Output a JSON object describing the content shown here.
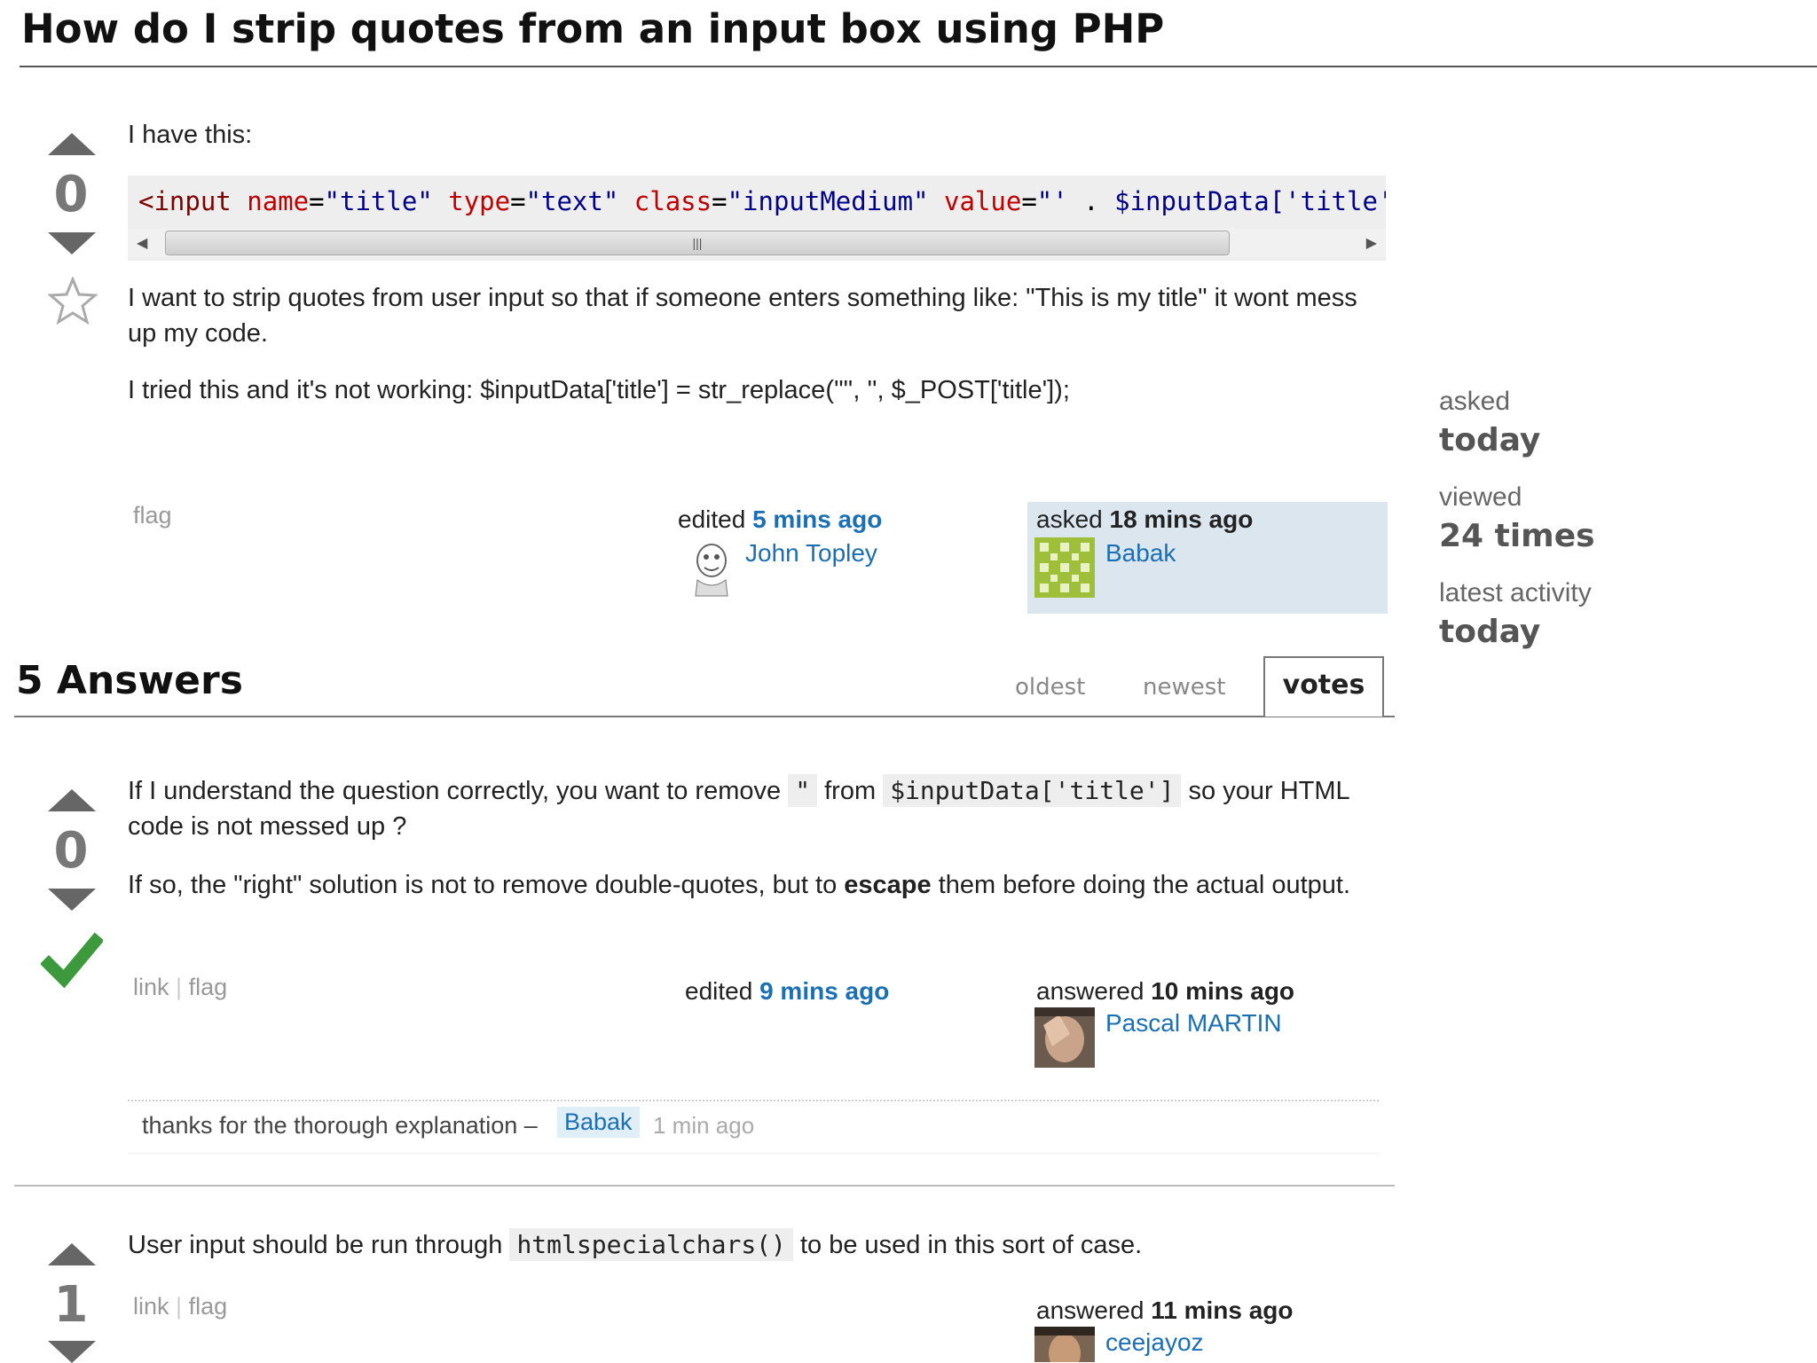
{
  "question": {
    "title": "How do I strip quotes from an input box using PHP",
    "votes": "0",
    "intro": "I have this:",
    "code": {
      "tag": "<input",
      "a1": "name",
      "v1": "\"title\"",
      "a2": "type",
      "v2": "\"text\"",
      "a3": "class",
      "v3": "\"inputMedium\"",
      "a4": "value",
      "v4": "\"'",
      "dot": " . ",
      "var": "$inputData['title']"
    },
    "para1": "I want to strip quotes from user input so that if someone enters something like: \"This is my title\" it wont mess up my code.",
    "para2": "I tried this and it's not working: $inputData['title'] = str_replace('\"', '', $_POST['title']);",
    "flag": "flag",
    "edited_label": "edited",
    "edited_time": "5 mins ago",
    "editor": "John Topley",
    "asked_label": "asked",
    "asked_time": "18 mins ago",
    "asker": "Babak"
  },
  "sidebar": {
    "asked_label": "asked",
    "asked_value": "today",
    "viewed_label": "viewed",
    "viewed_value": "24 times",
    "activity_label": "latest activity",
    "activity_value": "today"
  },
  "answers": {
    "header": "5 Answers",
    "tabs": [
      "oldest",
      "newest",
      "votes"
    ]
  },
  "answer1": {
    "votes": "0",
    "p1a": "If I understand the question correctly, you want to remove",
    "c1": "\"",
    "p1b": "from",
    "c2": "$inputData['title']",
    "p1c": "so your HTML code is not messed up ?",
    "p2a": "If so, the \"right\" solution is not to remove double-quotes, but to",
    "p2b": "escape",
    "p2c": "them before doing the actual output.",
    "link": "link",
    "sep": "|",
    "flag": "flag",
    "edited_label": "edited",
    "edited_time": "9 mins ago",
    "answered_label": "answered",
    "answered_time": "10 mins ago",
    "author": "Pascal MARTIN",
    "comment": {
      "text": "thanks for the thorough explanation –",
      "user": "Babak",
      "time": "1 min ago"
    }
  },
  "answer2": {
    "votes": "1",
    "p1a": "User input should be run through",
    "c1": "htmlspecialchars()",
    "p1b": "to be used in this sort of case.",
    "link": "link",
    "sep": "|",
    "flag": "flag",
    "answered_label": "answered",
    "answered_time": "11 mins ago",
    "author": "ceejayoz"
  }
}
